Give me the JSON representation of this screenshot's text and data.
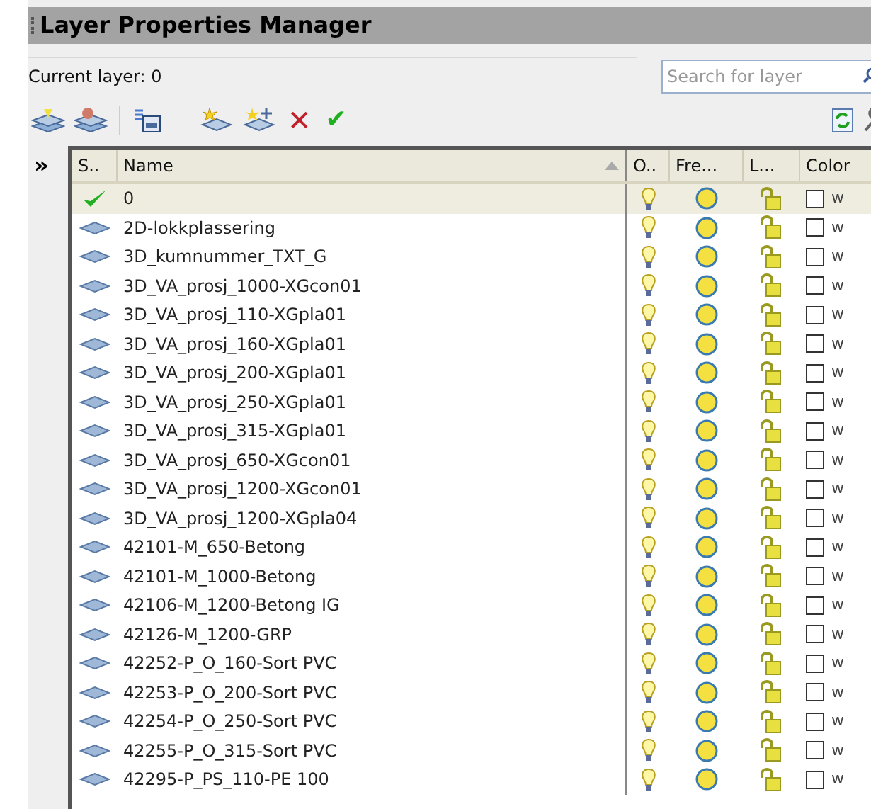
{
  "window": {
    "title": "Layer Properties Manager"
  },
  "current_layer": "Current layer: 0",
  "search": {
    "placeholder": "Search for layer"
  },
  "toolbar": {
    "delete_mark": "✕",
    "set_current_mark": "✔"
  },
  "panel_toggle": "»",
  "table": {
    "columns": [
      "S..",
      "Name",
      "O..",
      "Fre...",
      "L...",
      "Color"
    ],
    "rows": [
      {
        "current": true,
        "name": "0",
        "on": true,
        "frozen": false,
        "locked": false,
        "color_name": "w",
        "selected": true
      },
      {
        "current": false,
        "name": "2D-lokkplassering",
        "on": true,
        "frozen": false,
        "locked": false,
        "color_name": "w",
        "selected": false
      },
      {
        "current": false,
        "name": "3D_kumnummer_TXT_G",
        "on": true,
        "frozen": false,
        "locked": false,
        "color_name": "w",
        "selected": false
      },
      {
        "current": false,
        "name": "3D_VA_prosj_1000-XGcon01",
        "on": true,
        "frozen": false,
        "locked": false,
        "color_name": "w",
        "selected": false
      },
      {
        "current": false,
        "name": "3D_VA_prosj_110-XGpla01",
        "on": true,
        "frozen": false,
        "locked": false,
        "color_name": "w",
        "selected": false
      },
      {
        "current": false,
        "name": "3D_VA_prosj_160-XGpla01",
        "on": true,
        "frozen": false,
        "locked": false,
        "color_name": "w",
        "selected": false
      },
      {
        "current": false,
        "name": "3D_VA_prosj_200-XGpla01",
        "on": true,
        "frozen": false,
        "locked": false,
        "color_name": "w",
        "selected": false
      },
      {
        "current": false,
        "name": "3D_VA_prosj_250-XGpla01",
        "on": true,
        "frozen": false,
        "locked": false,
        "color_name": "w",
        "selected": false
      },
      {
        "current": false,
        "name": "3D_VA_prosj_315-XGpla01",
        "on": true,
        "frozen": false,
        "locked": false,
        "color_name": "w",
        "selected": false
      },
      {
        "current": false,
        "name": "3D_VA_prosj_650-XGcon01",
        "on": true,
        "frozen": false,
        "locked": false,
        "color_name": "w",
        "selected": false
      },
      {
        "current": false,
        "name": "3D_VA_prosj_1200-XGcon01",
        "on": true,
        "frozen": false,
        "locked": false,
        "color_name": "w",
        "selected": false
      },
      {
        "current": false,
        "name": "3D_VA_prosj_1200-XGpla04",
        "on": true,
        "frozen": false,
        "locked": false,
        "color_name": "w",
        "selected": false
      },
      {
        "current": false,
        "name": "42101-M_650-Betong",
        "on": true,
        "frozen": false,
        "locked": false,
        "color_name": "w",
        "selected": false
      },
      {
        "current": false,
        "name": "42101-M_1000-Betong",
        "on": true,
        "frozen": false,
        "locked": false,
        "color_name": "w",
        "selected": false
      },
      {
        "current": false,
        "name": "42106-M_1200-Betong IG",
        "on": true,
        "frozen": false,
        "locked": false,
        "color_name": "w",
        "selected": false
      },
      {
        "current": false,
        "name": "42126-M_1200-GRP",
        "on": true,
        "frozen": false,
        "locked": false,
        "color_name": "w",
        "selected": false
      },
      {
        "current": false,
        "name": "42252-P_O_160-Sort PVC",
        "on": true,
        "frozen": false,
        "locked": false,
        "color_name": "w",
        "selected": false
      },
      {
        "current": false,
        "name": "42253-P_O_200-Sort PVC",
        "on": true,
        "frozen": false,
        "locked": false,
        "color_name": "w",
        "selected": false
      },
      {
        "current": false,
        "name": "42254-P_O_250-Sort PVC",
        "on": true,
        "frozen": false,
        "locked": false,
        "color_name": "w",
        "selected": false
      },
      {
        "current": false,
        "name": "42255-P_O_315-Sort PVC",
        "on": true,
        "frozen": false,
        "locked": false,
        "color_name": "w",
        "selected": false
      },
      {
        "current": false,
        "name": "42295-P_PS_110-PE 100",
        "on": true,
        "frozen": false,
        "locked": false,
        "color_name": "w",
        "selected": false
      }
    ]
  }
}
